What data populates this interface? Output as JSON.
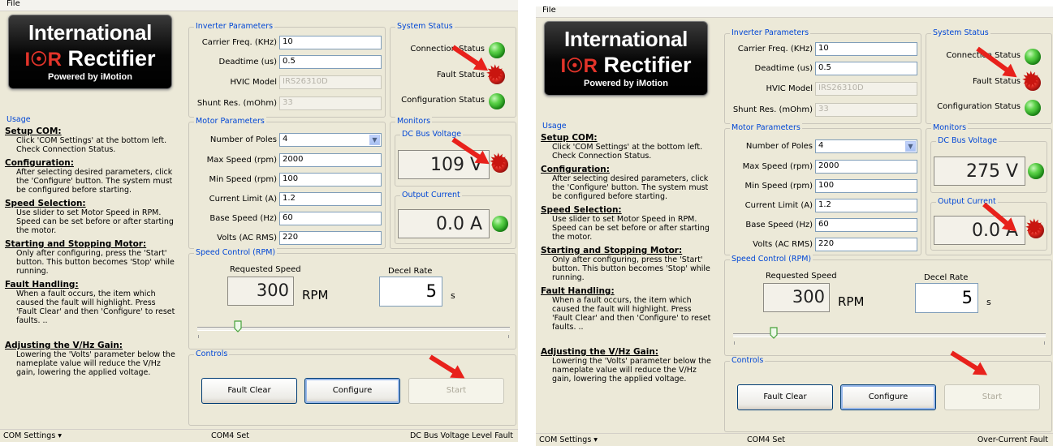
{
  "panels": [
    {
      "menu": {
        "file": "File"
      },
      "logo": {
        "line1": "International",
        "ior": "I☉R",
        "rectifier": "Rectifier",
        "powered": "Powered by iMotion"
      },
      "inverter": {
        "title": "Inverter Parameters",
        "carrier_label": "Carrier Freq. (KHz)",
        "carrier_value": "10",
        "deadtime_label": "Deadtime (us)",
        "deadtime_value": "0.5",
        "hvic_label": "HVIC Model",
        "hvic_value": "IRS26310D",
        "shunt_label": "Shunt Res. (mOhm)",
        "shunt_value": "33"
      },
      "system": {
        "title": "System Status",
        "connection_label": "Connection Status",
        "connection_state": "ok",
        "fault_label": "Fault Status",
        "fault_state": "fault",
        "config_label": "Configuration Status",
        "config_state": "ok"
      },
      "motor": {
        "title": "Motor Parameters",
        "poles_label": "Number of Poles",
        "poles_value": "4",
        "max_label": "Max Speed (rpm)",
        "max_value": "2000",
        "min_label": "Min Speed (rpm)",
        "min_value": "100",
        "current_label": "Current Limit (A)",
        "current_value": "1.2",
        "base_label": "Base Speed (Hz)",
        "base_value": "60",
        "volts_label": "Volts (AC RMS)",
        "volts_value": "220"
      },
      "monitors": {
        "title": "Monitors",
        "dc_title": "DC Bus Voltage",
        "dc_value": "109 V",
        "dc_state": "fault",
        "out_title": "Output Current",
        "out_value": "0.0 A",
        "out_state": "ok"
      },
      "usage": {
        "title": "Usage",
        "sections": [
          {
            "h": "Setup COM:",
            "t": "Click 'COM Settings' at the bottom left. Check Connection Status."
          },
          {
            "h": "Configuration:",
            "t": "After selecting desired parameters, click the 'Configure' button. The system must be configured before starting."
          },
          {
            "h": "Speed Selection:",
            "t": "Use slider to set Motor Speed in RPM. Speed can be set before or after starting the motor."
          },
          {
            "h": "Starting and Stopping Motor:",
            "t": "Only after configuring, press the 'Start' button. This button becomes 'Stop' while running."
          },
          {
            "h": "Fault Handling:",
            "t": "When a fault occurs, the item which caused the fault will highlight. Press 'Fault Clear' and then 'Configure' to reset faults. .."
          },
          {
            "h": "Adjusting the V/Hz Gain:",
            "t": "Lowering the 'Volts' parameter below the nameplate value will reduce the V/Hz gain, lowering the applied voltage."
          }
        ]
      },
      "speed": {
        "title": "Speed Control (RPM)",
        "req_label": "Requested Speed",
        "req_value": "300",
        "rpm_unit": "RPM",
        "decel_label": "Decel Rate",
        "decel_value": "5",
        "decel_unit": "s",
        "slider_fraction": 0.13
      },
      "controls": {
        "title": "Controls",
        "fault_clear": "Fault Clear",
        "configure": "Configure",
        "start": "Start"
      },
      "statusbar": {
        "com": "COM Settings ▾",
        "port": "COM4 Set",
        "fault": "DC Bus Voltage Level Fault"
      }
    },
    {
      "menu": {
        "file": "File"
      },
      "logo": {
        "line1": "International",
        "ior": "I☉R",
        "rectifier": "Rectifier",
        "powered": "Powered by iMotion"
      },
      "inverter": {
        "title": "Inverter Parameters",
        "carrier_label": "Carrier Freq. (KHz)",
        "carrier_value": "10",
        "deadtime_label": "Deadtime (us)",
        "deadtime_value": "0.5",
        "hvic_label": "HVIC Model",
        "hvic_value": "IRS26310D",
        "shunt_label": "Shunt Res. (mOhm)",
        "shunt_value": "33"
      },
      "system": {
        "title": "System Status",
        "connection_label": "Connection Status",
        "connection_state": "ok",
        "fault_label": "Fault Status",
        "fault_state": "fault",
        "config_label": "Configuration Status",
        "config_state": "ok"
      },
      "motor": {
        "title": "Motor Parameters",
        "poles_label": "Number of Poles",
        "poles_value": "4",
        "max_label": "Max Speed (rpm)",
        "max_value": "2000",
        "min_label": "Min Speed (rpm)",
        "min_value": "100",
        "current_label": "Current Limit (A)",
        "current_value": "1.2",
        "base_label": "Base Speed (Hz)",
        "base_value": "60",
        "volts_label": "Volts (AC RMS)",
        "volts_value": "220"
      },
      "monitors": {
        "title": "Monitors",
        "dc_title": "DC Bus Voltage",
        "dc_value": "275 V",
        "dc_state": "ok",
        "out_title": "Output Current",
        "out_value": "0.0 A",
        "out_state": "fault"
      },
      "usage": {
        "title": "Usage",
        "sections": [
          {
            "h": "Setup COM:",
            "t": "Click 'COM Settings' at the bottom left. Check Connection Status."
          },
          {
            "h": "Configuration:",
            "t": "After selecting desired parameters, click the 'Configure' button. The system must be configured before starting."
          },
          {
            "h": "Speed Selection:",
            "t": "Use slider to set Motor Speed in RPM. Speed can be set before or after starting the motor."
          },
          {
            "h": "Starting and Stopping Motor:",
            "t": "Only after configuring, press the 'Start' button. This button becomes 'Stop' while running."
          },
          {
            "h": "Fault Handling:",
            "t": "When a fault occurs, the item which caused the fault will highlight. Press 'Fault Clear' and then 'Configure' to reset faults. .."
          },
          {
            "h": "Adjusting the V/Hz Gain:",
            "t": "Lowering the 'Volts' parameter below the nameplate value will reduce the V/Hz gain, lowering the applied voltage."
          }
        ]
      },
      "speed": {
        "title": "Speed Control (RPM)",
        "req_label": "Requested Speed",
        "req_value": "300",
        "rpm_unit": "RPM",
        "decel_label": "Decel Rate",
        "decel_value": "5",
        "decel_unit": "s",
        "slider_fraction": 0.13
      },
      "controls": {
        "title": "Controls",
        "fault_clear": "Fault Clear",
        "configure": "Configure",
        "start": "Start"
      },
      "statusbar": {
        "com": "COM Settings ▾",
        "port": "COM4 Set",
        "fault": "Over-Current Fault"
      }
    }
  ],
  "colors": {
    "accent": "#0046d5",
    "led_ok": "#22a31b",
    "led_fault": "#c9150f",
    "arrow": "#e8211b"
  }
}
